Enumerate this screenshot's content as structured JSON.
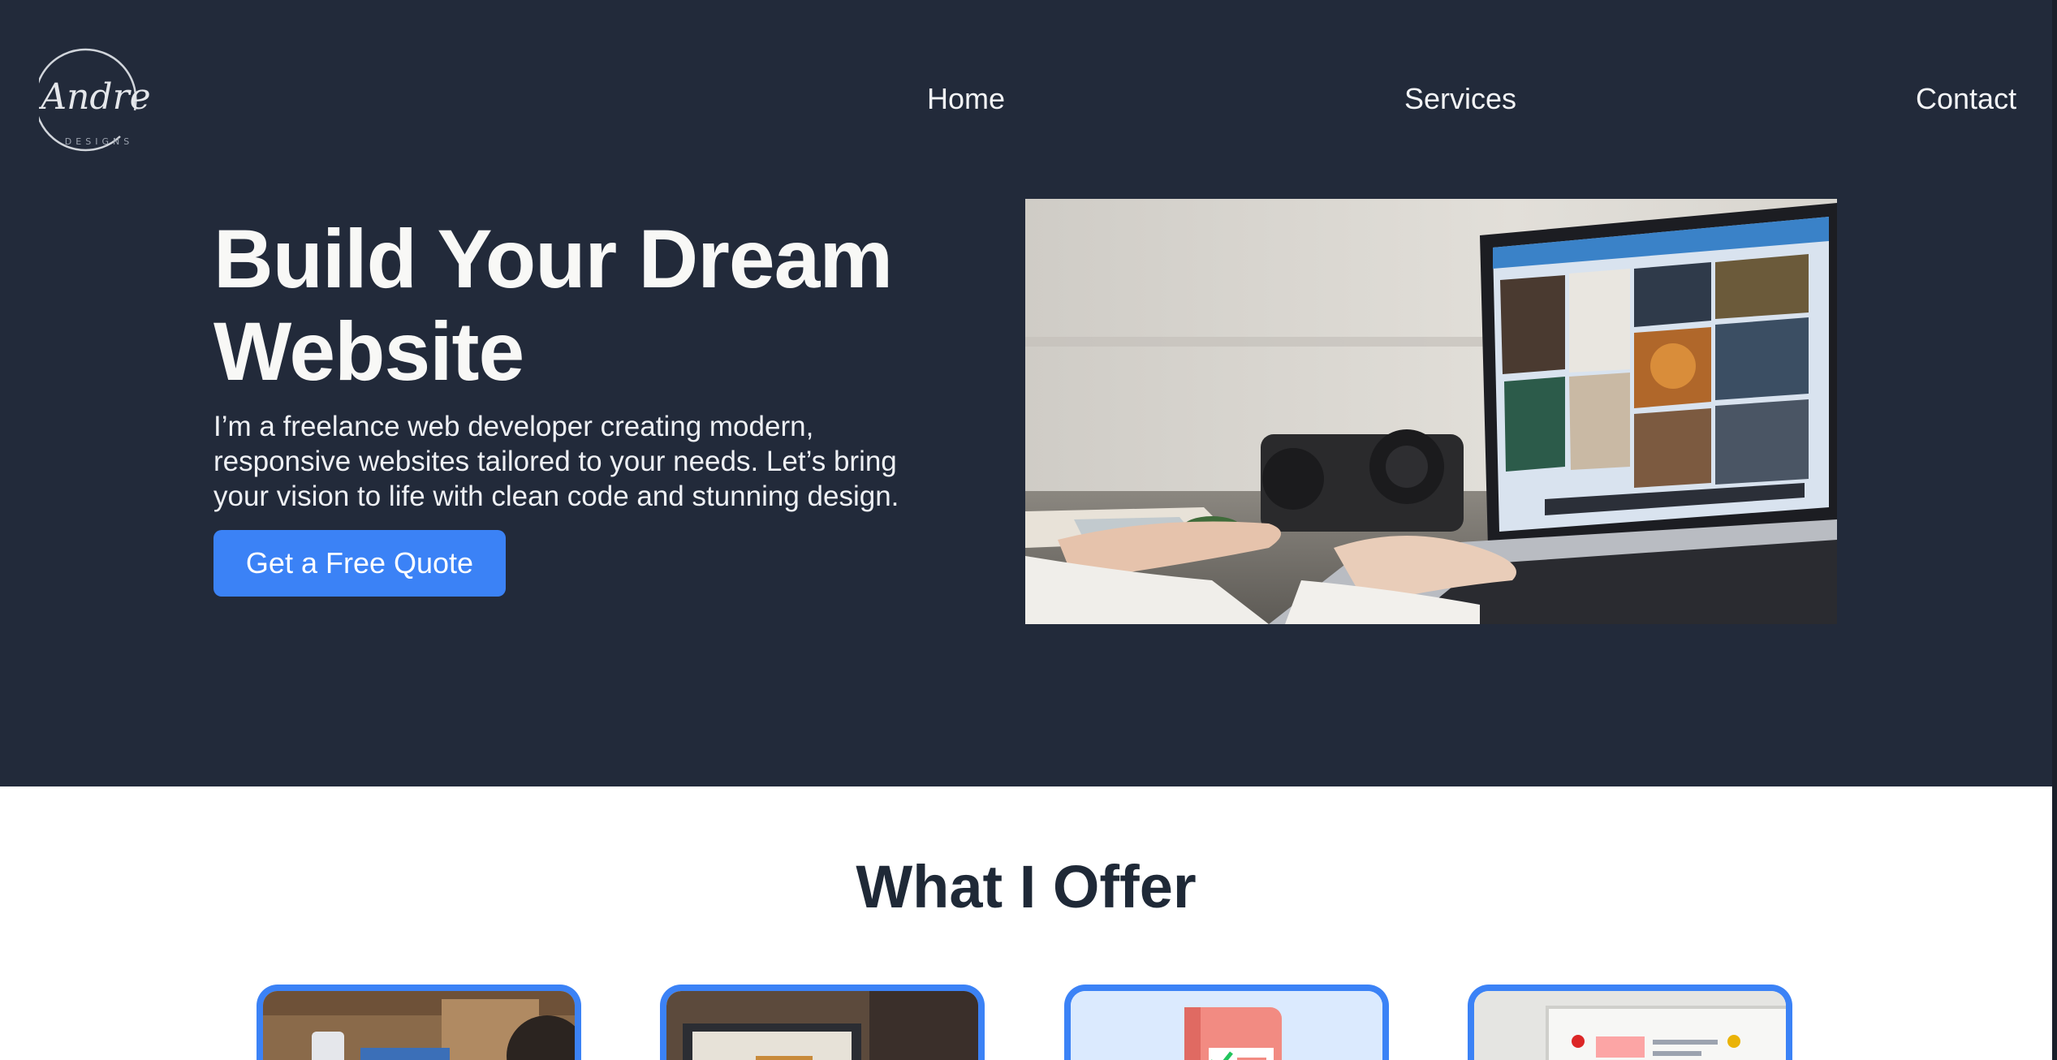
{
  "logo": {
    "text": "Andre",
    "subtext": "DESIGNS"
  },
  "nav": {
    "items": [
      {
        "label": "Home"
      },
      {
        "label": "Services"
      },
      {
        "label": "Contact"
      }
    ]
  },
  "hero": {
    "headline": "Build Your Dream Website",
    "subtext": "I’m a freelance web developer creating modern, responsive websites tailored to your needs. Let’s bring your vision to life with clean code and stunning design.",
    "cta_label": "Get a Free Quote"
  },
  "offer": {
    "title": "What I Offer"
  },
  "colors": {
    "hero_bg": "#222a3a",
    "accent": "#3b82f6",
    "heading_dark": "#1f2937",
    "light_text": "#f8f8f6"
  }
}
